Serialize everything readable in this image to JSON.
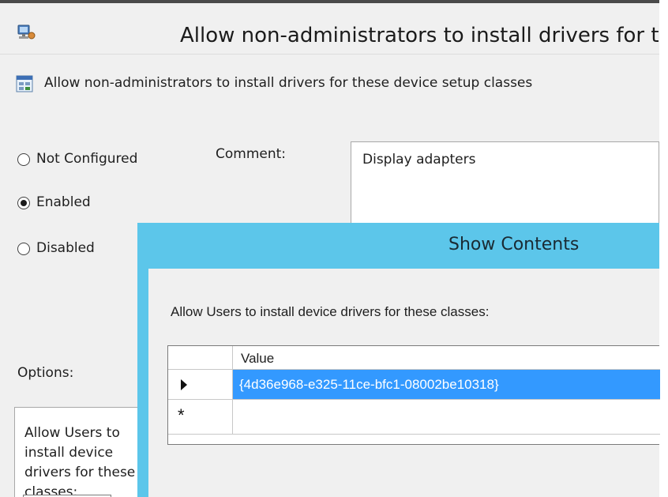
{
  "main_window": {
    "title": "Allow non-administrators to install drivers for t",
    "setting_name": "Allow non-administrators to install drivers for these device setup classes",
    "radio_options": [
      {
        "label": "Not Configured",
        "selected": false
      },
      {
        "label": "Enabled",
        "selected": true
      },
      {
        "label": "Disabled",
        "selected": false
      }
    ],
    "comment_label": "Comment:",
    "comment_value": "Display adapters",
    "options_label": "Options:",
    "options_text": "Allow Users to install device drivers for these classes:"
  },
  "show_contents": {
    "title": "Show Contents",
    "prompt": "Allow Users to install device drivers for these classes:",
    "grid": {
      "column_header": "Value",
      "rows": [
        "{4d36e968-e325-11ce-bfc1-08002be10318}"
      ],
      "new_row_marker": "*"
    }
  },
  "colors": {
    "dialog_frame": "#5cc6ea",
    "selection": "#3399ff",
    "window_bg": "#f0f0f0"
  }
}
